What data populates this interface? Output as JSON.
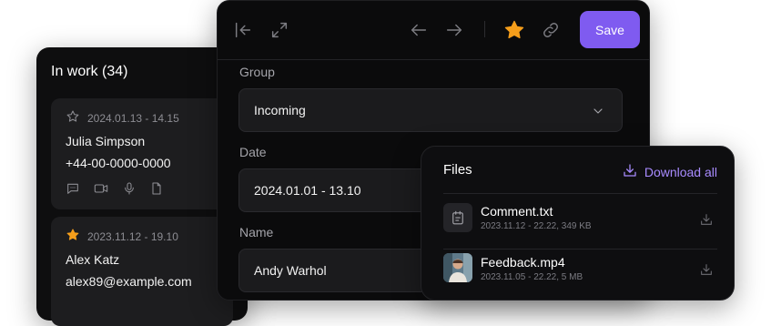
{
  "inwork": {
    "title": "In work (34)",
    "cards": [
      {
        "date": "2024.01.13 - 14.15",
        "name": "Julia Simpson",
        "contact": "+44-00-0000-0000",
        "starred": false
      },
      {
        "date": "2023.11.12 - 19.10",
        "name": "Alex Katz",
        "contact": "alex89@example.com",
        "starred": true
      }
    ],
    "action_icons": [
      "comment-icon",
      "video-icon",
      "microphone-icon",
      "document-icon"
    ]
  },
  "toolbar": {
    "icons": [
      "collapse-left-icon",
      "expand-icon",
      "arrow-left-icon",
      "arrow-right-icon",
      "star-icon",
      "link-icon"
    ],
    "save_label": "Save"
  },
  "form": {
    "group": {
      "label": "Group",
      "value": "Incoming"
    },
    "date": {
      "label": "Date",
      "value": "2024.01.01 - 13.10"
    },
    "name": {
      "label": "Name",
      "value": "Andy Warhol"
    }
  },
  "files": {
    "title": "Files",
    "download_all": "Download all",
    "items": [
      {
        "name": "Comment.txt",
        "meta": "2023.11.12 - 22.22, 349 KB",
        "icon": "text-file-icon"
      },
      {
        "name": "Feedback.mp4",
        "meta": "2023.11.05 - 22.22, 5 MB",
        "icon": "video-thumbnail"
      }
    ]
  },
  "colors": {
    "accent": "#7f5bf0",
    "link": "#a88bff",
    "star_active": "#f59e1b",
    "panel": "#0b0b0c",
    "field": "#1b1b1d"
  }
}
